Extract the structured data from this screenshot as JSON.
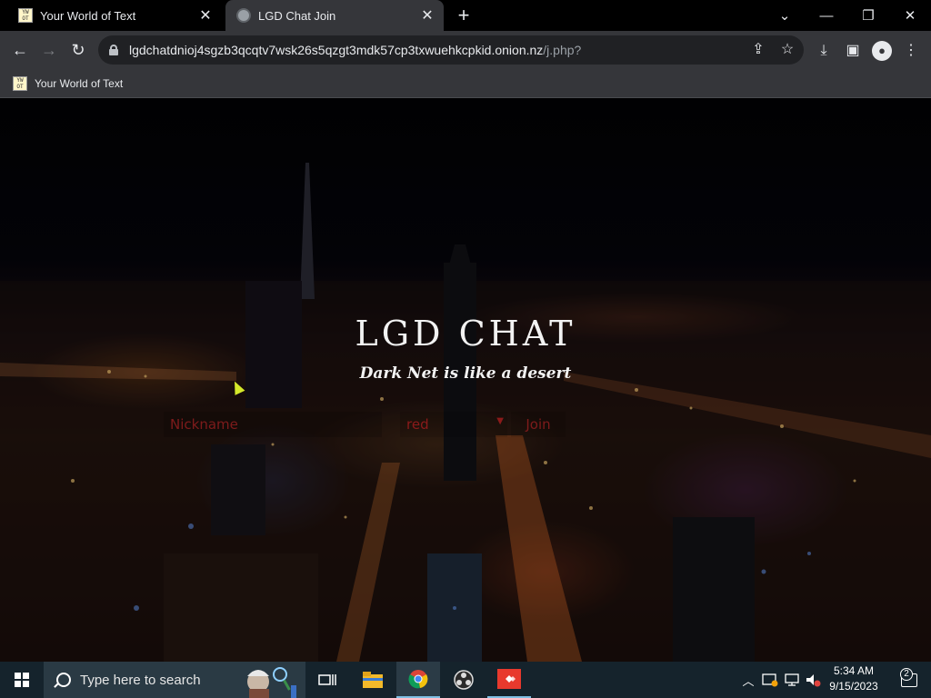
{
  "browser": {
    "tabs": [
      {
        "title": "Your World of Text",
        "active": false,
        "favicon": "ywot-favicon"
      },
      {
        "title": "LGD Chat Join",
        "active": true,
        "favicon": "globe-icon"
      }
    ],
    "address": {
      "host": "lgdchatdnioj4sgzb3qcqtv7wsk26s5qzgt3mdk57cp3txwuehkcpkid.onion.nz",
      "path": "/j.php?"
    },
    "bookmarks": [
      {
        "label": "Your World of Text",
        "favicon": "ywot-favicon"
      }
    ],
    "favicon_text": "YW OT"
  },
  "page": {
    "title": "LGD CHAT",
    "subtitle": "Dark Net is like a desert",
    "form": {
      "nickname_placeholder": "Nickname",
      "color_selected": "red",
      "join_label": "Join"
    },
    "colors": {
      "form_text": "#8b1a1a",
      "title_text": "#f2f2f2"
    }
  },
  "taskbar": {
    "search_placeholder": "Type here to search",
    "clock_time": "5:34 AM",
    "clock_date": "9/15/2023",
    "notification_count": "2",
    "pinned_apps": [
      "task-view-icon",
      "file-explorer-icon",
      "chrome-icon",
      "obs-icon",
      "anydesk-icon"
    ]
  }
}
